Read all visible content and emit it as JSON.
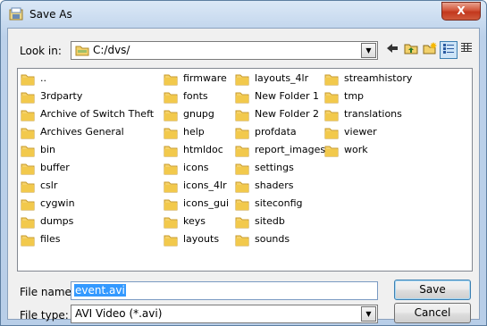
{
  "window": {
    "title": "Save As",
    "close_label": "X"
  },
  "look_in": {
    "label": "Look in:",
    "value": "C:/dvs/"
  },
  "toolbar": {
    "icons": [
      "back-arrow-icon",
      "up-folder-icon",
      "new-folder-icon",
      "list-view-icon",
      "details-view-icon"
    ]
  },
  "files": {
    "columns": [
      [
        "..",
        "3rdparty",
        "Archive of Switch Theft",
        "Archives General",
        "bin",
        "buffer",
        "cslr",
        "cygwin",
        "dumps",
        "files"
      ],
      [
        "firmware",
        "fonts",
        "gnupg",
        "help",
        "htmldoc",
        "icons",
        "icons_4lr",
        "icons_gui",
        "keys",
        "layouts"
      ],
      [
        "layouts_4lr",
        "New Folder 1",
        "New Folder 2",
        "profdata",
        "report_images",
        "settings",
        "shaders",
        "siteconfig",
        "sitedb",
        "sounds"
      ],
      [
        "streamhistory",
        "tmp",
        "translations",
        "viewer",
        "work"
      ]
    ]
  },
  "file_name": {
    "label": "File name:",
    "value": "event.avi"
  },
  "file_type": {
    "label": "File type:",
    "value": "AVI Video (*.avi)"
  },
  "buttons": {
    "save": "Save",
    "cancel": "Cancel"
  },
  "colors": {
    "selection": "#3399ff",
    "folder": "#f2c94c",
    "close": "#c3381d"
  }
}
